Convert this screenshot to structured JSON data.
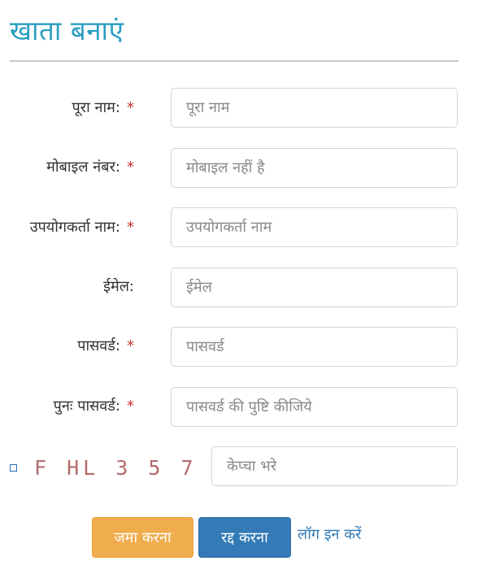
{
  "page": {
    "title": "खाता बनाएं"
  },
  "form": {
    "fields": [
      {
        "label": "पूरा नाम:",
        "placeholder": "पूरा नाम",
        "required": true
      },
      {
        "label": "मोबाइल नंबर:",
        "placeholder": "मोबाइल नहीं है",
        "required": true
      },
      {
        "label": "उपयोगकर्ता नाम:",
        "placeholder": "उपयोगकर्ता नाम",
        "required": true
      },
      {
        "label": "ईमेल:",
        "placeholder": "ईमेल",
        "required": false
      },
      {
        "label": "पासवर्ड:",
        "placeholder": "पासवर्ड",
        "required": true
      },
      {
        "label": "पुनः पासवर्ड:",
        "placeholder": "पासवर्ड की पुष्टि कीजिये",
        "required": true
      }
    ],
    "required_marker": "*",
    "captcha": {
      "code": "FHL357",
      "placeholder": "केप्चा भरे"
    },
    "buttons": {
      "submit": "जमा करना",
      "cancel": "रद्द करना"
    },
    "login_link": "लॉग इन करें"
  },
  "colors": {
    "title": "#2a9ec0",
    "required": "#c9302c",
    "submit": "#f0ad4e",
    "cancel": "#337ab7",
    "link": "#337ab7"
  }
}
